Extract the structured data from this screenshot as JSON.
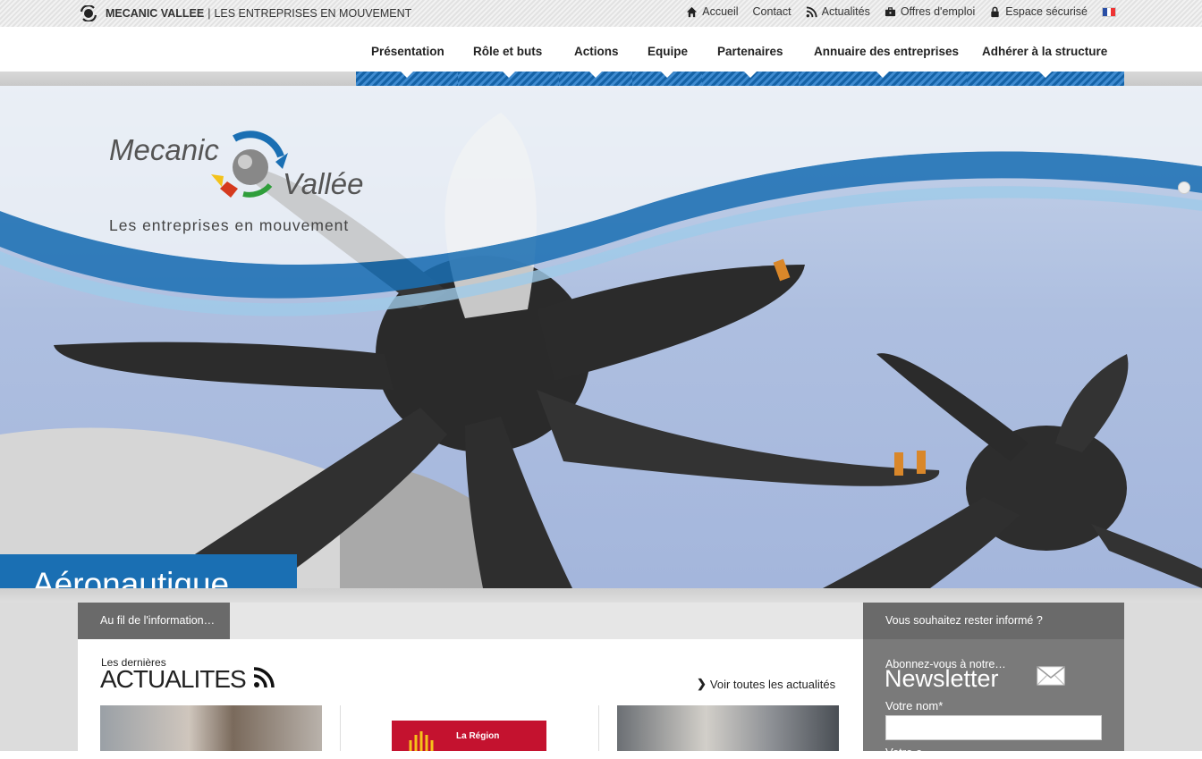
{
  "topbar": {
    "brand_name": "MECANIC VALLEE",
    "brand_separator": "|",
    "brand_tagline": "LES ENTREPRISES EN MOUVEMENT",
    "links": [
      {
        "label": "Accueil",
        "icon": "home-icon"
      },
      {
        "label": "Contact",
        "icon": ""
      },
      {
        "label": "Actualités",
        "icon": "rss-icon"
      },
      {
        "label": "Offres d'emploi",
        "icon": "briefcase-icon"
      },
      {
        "label": "Espace sécurisé",
        "icon": "lock-icon"
      }
    ],
    "language_flag": "flag-fr-icon"
  },
  "nav": {
    "items": [
      "Présentation",
      "Rôle et buts",
      "Actions",
      "Equipe",
      "Partenaires",
      "Annuaire des entreprises",
      "Adhérer à la structure"
    ]
  },
  "hero": {
    "logo_line1": "Mecanic",
    "logo_line2": "Vallée",
    "logo_tagline": "Les entreprises en mouvement",
    "caption": "Aéronautique"
  },
  "content": {
    "info_tab": "Au fil de l'information…",
    "news_small": "Les dernières",
    "news_big": "ACTUALITES",
    "see_all": "Voir toutes les actualités",
    "card2_text": "La Région"
  },
  "sidebar": {
    "header": "Vous souhaitez rester informé ?",
    "newsletter_small": "Abonnez-vous à notre…",
    "newsletter_big": "Newsletter",
    "name_label": "Votre nom*",
    "name_value": "",
    "next_label": "Votre e..."
  },
  "colors": {
    "accent_blue": "#1a6fb3",
    "nav_stripe": "#1563a7",
    "panel_grey": "#6a6a6a"
  }
}
